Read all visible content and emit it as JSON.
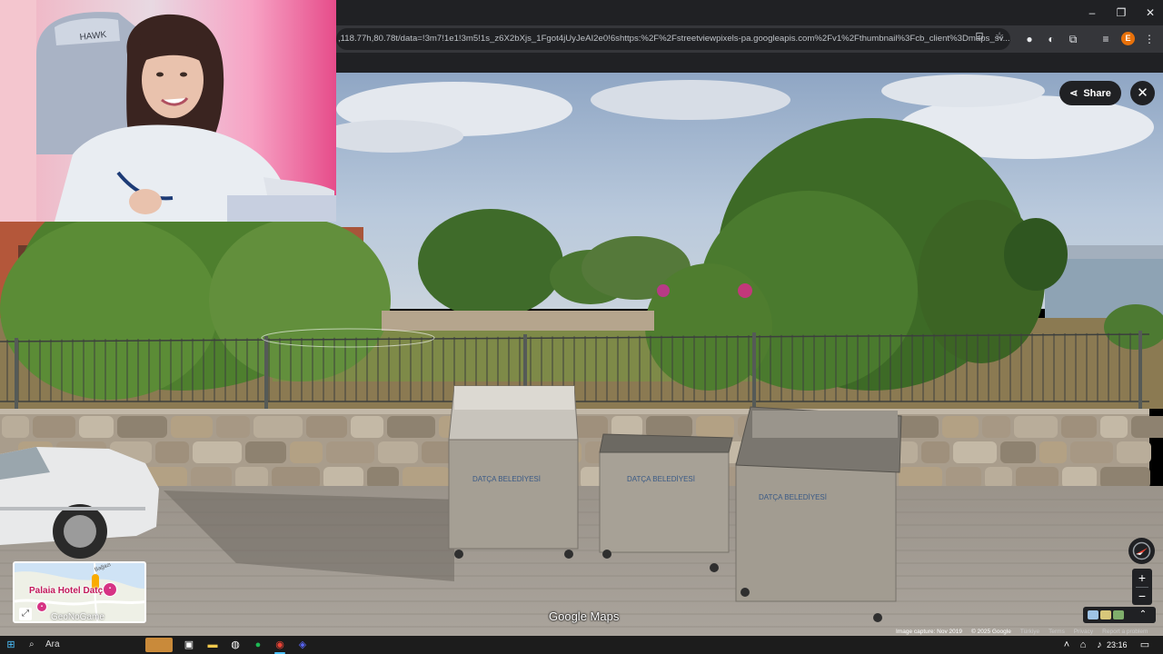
{
  "browser": {
    "url": ",118.77h,80.78t/data=!3m7!1e1!3m5!1s_z6X2bXjs_1Fgot4jUyJeAI2e0!6shttps:%2F%2Fstreetviewpixels-pa.googleapis.com%2Fv1%2Fthumbnail%3Fcb_client%3Dmaps_sv...",
    "profile_initial": "E",
    "icons": [
      "install-icon",
      "star-icon",
      "extension-icon",
      "extension-icon",
      "puzzle-icon",
      "media-icon",
      "menu-icon"
    ]
  },
  "window_controls": {
    "minimize": "–",
    "restore": "❐",
    "close": "✕"
  },
  "streetview": {
    "share_label": "Share",
    "close_label": "✕",
    "logo_text": "Google Maps",
    "zoom_in": "+",
    "zoom_out": "−",
    "attribution": {
      "capture": "Image capture: Nov 2019",
      "copyright": "© 2025 Google",
      "country": "Türkiye",
      "terms": "Terms",
      "privacy": "Privacy",
      "report": "Report a problem"
    },
    "bin_text": "DATÇA BELEDİYESİ"
  },
  "minimap": {
    "place_label": "Palaia Hotel Datça",
    "road_label": "Bağazi",
    "watermark": "GeoNoGame"
  },
  "taskbar": {
    "search_label": "Ara",
    "time": "23:16"
  }
}
